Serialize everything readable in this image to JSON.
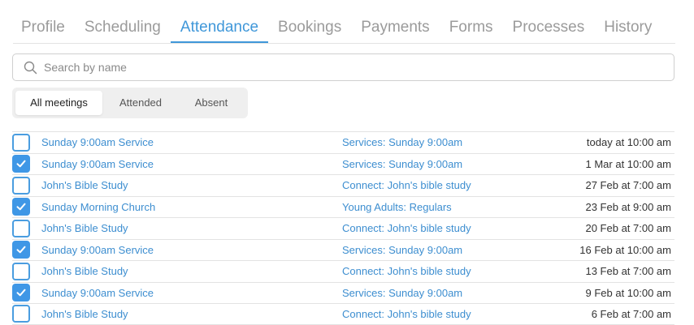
{
  "tabs": [
    {
      "label": "Profile"
    },
    {
      "label": "Scheduling"
    },
    {
      "label": "Attendance"
    },
    {
      "label": "Bookings"
    },
    {
      "label": "Payments"
    },
    {
      "label": "Forms"
    },
    {
      "label": "Processes"
    },
    {
      "label": "History"
    }
  ],
  "active_tab": "Attendance",
  "search": {
    "placeholder": "Search by name",
    "value": "",
    "icon": "search-icon"
  },
  "filters": [
    {
      "label": "All meetings",
      "active": true
    },
    {
      "label": "Attended",
      "active": false
    },
    {
      "label": "Absent",
      "active": false
    }
  ],
  "colors": {
    "accent": "#3f97d9",
    "link": "#3d8ed0",
    "checkbox_fill": "#3f97e6",
    "tab_inactive": "#9b9b9b",
    "divider": "#e3e3e3"
  },
  "rows": [
    {
      "meeting": "Sunday 9:00am Service",
      "group": "Services: Sunday 9:00am",
      "time": "today at 10:00 am",
      "attended": false
    },
    {
      "meeting": "Sunday 9:00am Service",
      "group": "Services: Sunday 9:00am",
      "time": "1 Mar at 10:00 am",
      "attended": true
    },
    {
      "meeting": "John's Bible Study",
      "group": "Connect: John's bible study",
      "time": "27 Feb at 7:00 am",
      "attended": false
    },
    {
      "meeting": "Sunday Morning Church",
      "group": "Young Adults: Regulars",
      "time": "23 Feb at 9:00 am",
      "attended": true
    },
    {
      "meeting": "John's Bible Study",
      "group": "Connect: John's bible study",
      "time": "20 Feb at 7:00 am",
      "attended": false
    },
    {
      "meeting": "Sunday 9:00am Service",
      "group": "Services: Sunday 9:00am",
      "time": "16 Feb at 10:00 am",
      "attended": true
    },
    {
      "meeting": "John's Bible Study",
      "group": "Connect: John's bible study",
      "time": "13 Feb at 7:00 am",
      "attended": false
    },
    {
      "meeting": "Sunday 9:00am Service",
      "group": "Services: Sunday 9:00am",
      "time": "9 Feb at 10:00 am",
      "attended": true
    },
    {
      "meeting": "John's Bible Study",
      "group": "Connect: John's bible study",
      "time": "6 Feb at 7:00 am",
      "attended": false
    }
  ]
}
